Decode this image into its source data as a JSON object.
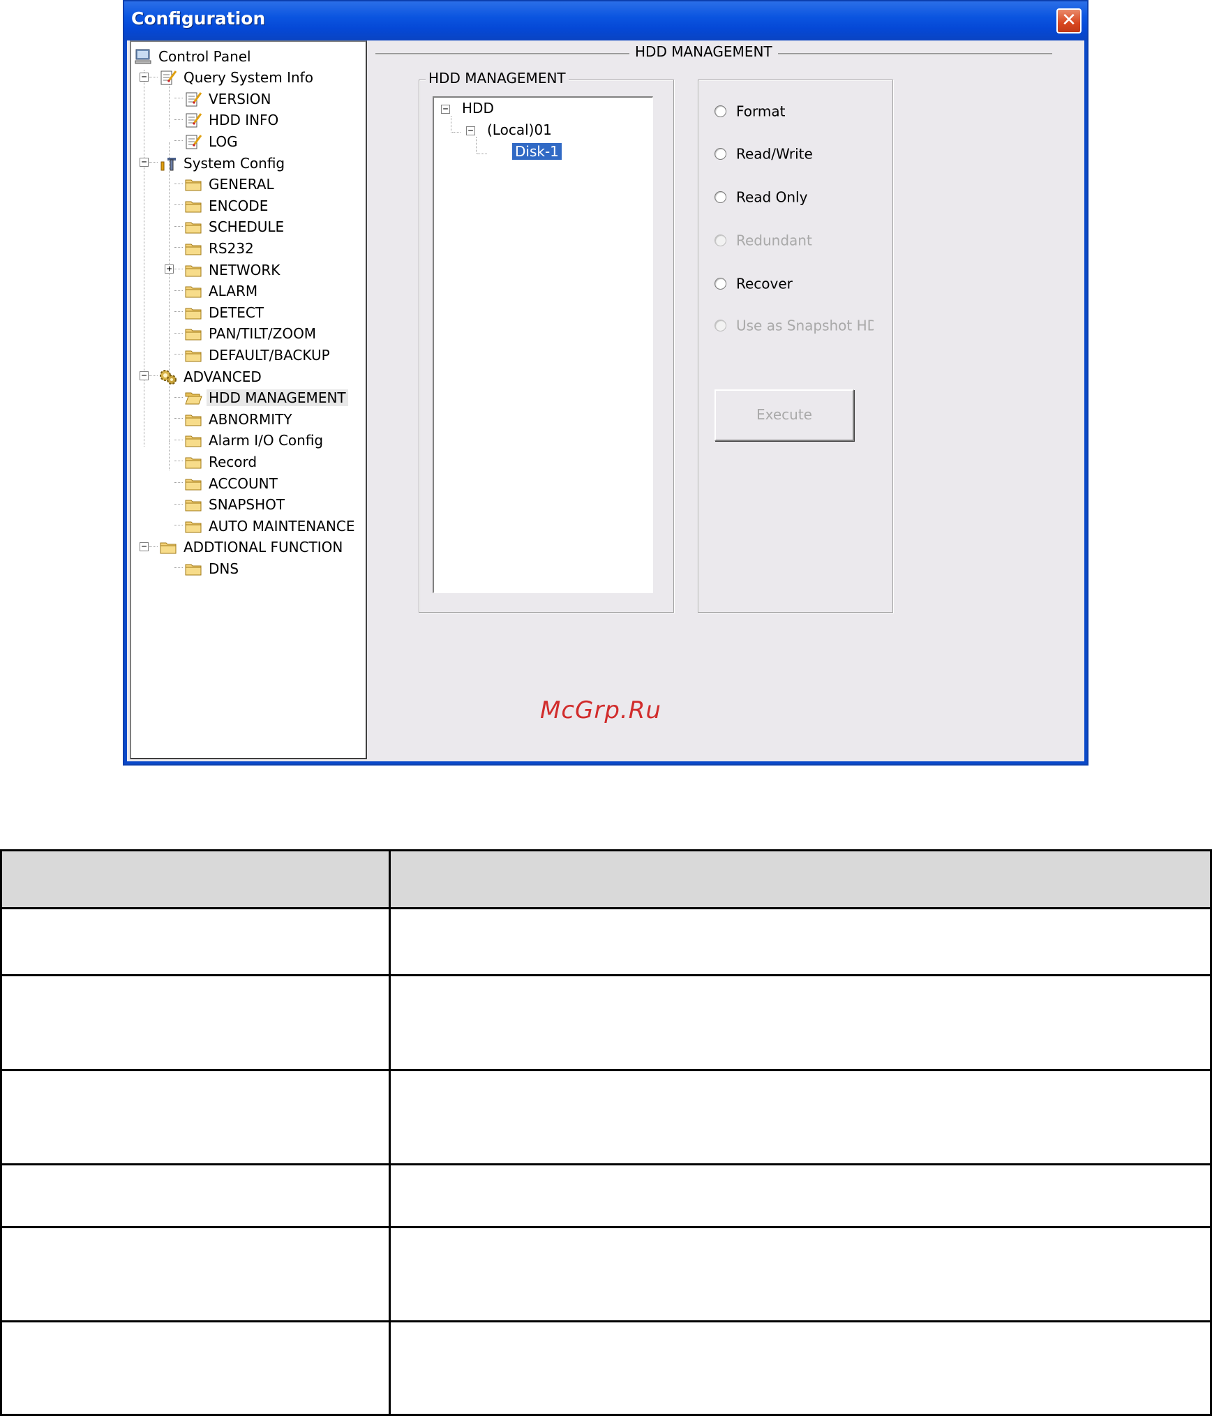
{
  "window": {
    "title": "Configuration",
    "close_label": "✕"
  },
  "tree": {
    "items": [
      {
        "label": "Control Panel",
        "icon": "computer-icon"
      },
      {
        "label": "Query System Info",
        "icon": "notepad-icon",
        "expander": "−"
      },
      {
        "label": "VERSION",
        "icon": "notepad-icon"
      },
      {
        "label": "HDD INFO",
        "icon": "notepad-icon"
      },
      {
        "label": "LOG",
        "icon": "notepad-icon"
      },
      {
        "label": "System Config",
        "icon": "tools-icon",
        "expander": "−"
      },
      {
        "label": "GENERAL",
        "icon": "folder-icon"
      },
      {
        "label": "ENCODE",
        "icon": "folder-icon"
      },
      {
        "label": "SCHEDULE",
        "icon": "folder-icon"
      },
      {
        "label": "RS232",
        "icon": "folder-icon"
      },
      {
        "label": "NETWORK",
        "icon": "folder-icon",
        "expander": "+"
      },
      {
        "label": "ALARM",
        "icon": "folder-icon"
      },
      {
        "label": "DETECT",
        "icon": "folder-icon"
      },
      {
        "label": "PAN/TILT/ZOOM",
        "icon": "folder-icon"
      },
      {
        "label": "DEFAULT/BACKUP",
        "icon": "folder-icon"
      },
      {
        "label": "ADVANCED",
        "icon": "gears-icon",
        "expander": "−"
      },
      {
        "label": "HDD MANAGEMENT",
        "icon": "open-folder-icon",
        "selected": true
      },
      {
        "label": "ABNORMITY",
        "icon": "folder-icon"
      },
      {
        "label": "Alarm I/O Config",
        "icon": "folder-icon"
      },
      {
        "label": "Record",
        "icon": "folder-icon"
      },
      {
        "label": "ACCOUNT",
        "icon": "folder-icon"
      },
      {
        "label": "SNAPSHOT",
        "icon": "folder-icon"
      },
      {
        "label": "AUTO MAINTENANCE",
        "icon": "folder-icon"
      },
      {
        "label": "ADDTIONAL FUNCTION",
        "icon": "folder-icon",
        "expander": "−"
      },
      {
        "label": "DNS",
        "icon": "folder-icon"
      }
    ]
  },
  "panel": {
    "header": "HDD MANAGEMENT",
    "group_label": "HDD MANAGEMENT",
    "hdd_tree": {
      "root": "HDD",
      "node": "(Local)01",
      "leaf": "Disk-1"
    },
    "options": [
      {
        "label": "Format",
        "enabled": true
      },
      {
        "label": "Read/Write",
        "enabled": true
      },
      {
        "label": "Read Only",
        "enabled": true
      },
      {
        "label": "Redundant",
        "enabled": false
      },
      {
        "label": "Recover",
        "enabled": true
      },
      {
        "label": "Use as Snapshot HD",
        "enabled": false
      }
    ],
    "execute_label": "Execute"
  },
  "watermark": "McGrp.Ru",
  "table": {
    "header": [
      "",
      ""
    ],
    "rows": [
      [
        "",
        ""
      ],
      [
        "",
        ""
      ],
      [
        "",
        ""
      ],
      [
        "",
        ""
      ],
      [
        "",
        ""
      ],
      [
        "",
        ""
      ]
    ]
  }
}
